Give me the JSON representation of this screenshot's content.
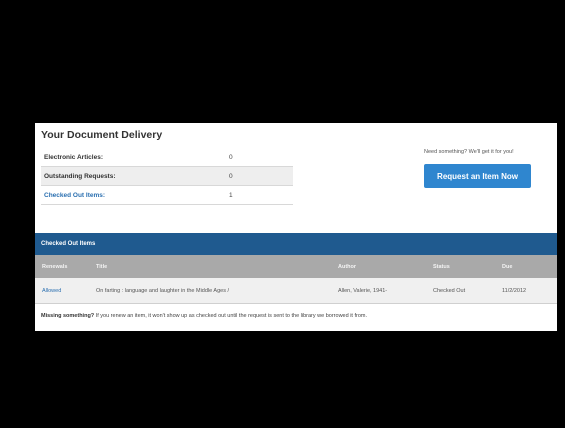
{
  "document_delivery": {
    "title": "Your Document Delivery",
    "summary": [
      {
        "label": "Electronic Articles:",
        "value": "0"
      },
      {
        "label": "Outstanding Requests:",
        "value": "0"
      },
      {
        "label": "Checked Out Items:",
        "value": "1"
      }
    ]
  },
  "request": {
    "prompt": "Need something? We'll get it for you!",
    "button_label": "Request an Item Now"
  },
  "checked_out": {
    "header": "Checked Out Items",
    "columns": [
      "Renewals",
      "Title",
      "Author",
      "Status",
      "Due"
    ],
    "rows": [
      {
        "renewals": "Allowed",
        "title": "On farting : language and laughter in the Middle Ages /",
        "author": "Allen, Valerie, 1941-",
        "status": "Checked Out",
        "due": "11/2/2012"
      }
    ]
  },
  "footer": {
    "bold": "Missing something?",
    "text": " If you renew an item, it won't show up as checked out until the request is sent to the library we borrowed it from."
  },
  "colors": {
    "accent_blue": "#2f86cf",
    "header_blue": "#1f5a8f",
    "link_blue": "#2a6fb0"
  }
}
